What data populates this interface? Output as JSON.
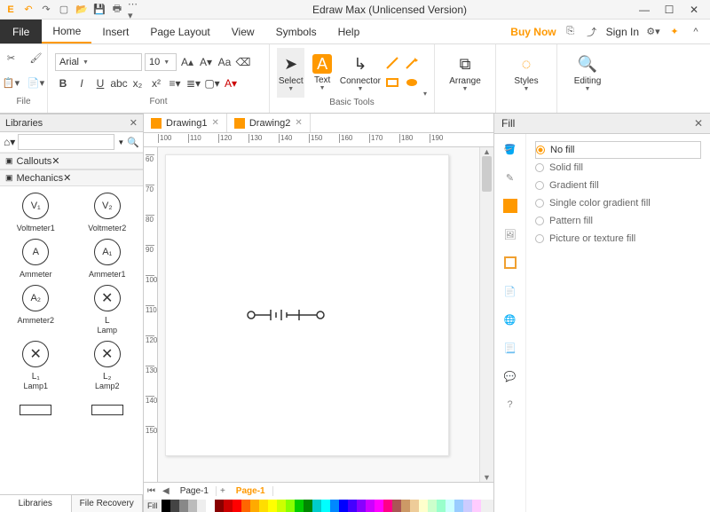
{
  "app": {
    "title": "Edraw Max (Unlicensed Version)"
  },
  "menus": {
    "file": "File",
    "items": [
      "Home",
      "Insert",
      "Page Layout",
      "View",
      "Symbols",
      "Help"
    ],
    "active": 0,
    "buynow": "Buy Now",
    "signin": "Sign In"
  },
  "ribbon": {
    "file_group": "File",
    "font": {
      "family": "Arial",
      "size": "10",
      "label": "Font"
    },
    "basic": {
      "select": "Select",
      "text": "Text",
      "connector": "Connector",
      "label": "Basic Tools"
    },
    "arrange": "Arrange",
    "styles": "Styles",
    "editing": "Editing"
  },
  "libraries": {
    "title": "Libraries",
    "sections": [
      "Callouts",
      "Mechanics"
    ],
    "shapes": [
      {
        "sym": "V₁",
        "name": "Voltmeter1"
      },
      {
        "sym": "V₂",
        "name": "Voltmeter2"
      },
      {
        "sym": "A",
        "name": "Ammeter"
      },
      {
        "sym": "A₁",
        "name": "Ammeter1"
      },
      {
        "sym": "A₂",
        "name": "Ammeter2"
      },
      {
        "sym": "x",
        "sub": "L",
        "name": "Lamp"
      },
      {
        "sym": "x",
        "sub": "L₁",
        "name": "Lamp1"
      },
      {
        "sym": "x",
        "sub": "L₂",
        "name": "Lamp2"
      },
      {
        "sym": "rect",
        "name": ""
      },
      {
        "sym": "rect",
        "name": ""
      }
    ],
    "tabs": [
      "Libraries",
      "File Recovery"
    ]
  },
  "docs": {
    "tabs": [
      "Drawing1",
      "Drawing2"
    ],
    "active": 1
  },
  "ruler_h": [
    "100",
    "110",
    "120",
    "130",
    "140",
    "150",
    "160",
    "170",
    "180",
    "190"
  ],
  "ruler_v": [
    "60",
    "70",
    "80",
    "90",
    "100",
    "110",
    "120",
    "130",
    "140",
    "150"
  ],
  "pages": {
    "nav": [
      "⏮",
      "◀"
    ],
    "cur": "Page-1",
    "add": "+",
    "active": "Page-1",
    "fill_lbl": "Fill"
  },
  "fill": {
    "title": "Fill",
    "options": [
      "No fill",
      "Solid fill",
      "Gradient fill",
      "Single color gradient fill",
      "Pattern fill",
      "Picture or texture fill"
    ],
    "selected": 0
  }
}
